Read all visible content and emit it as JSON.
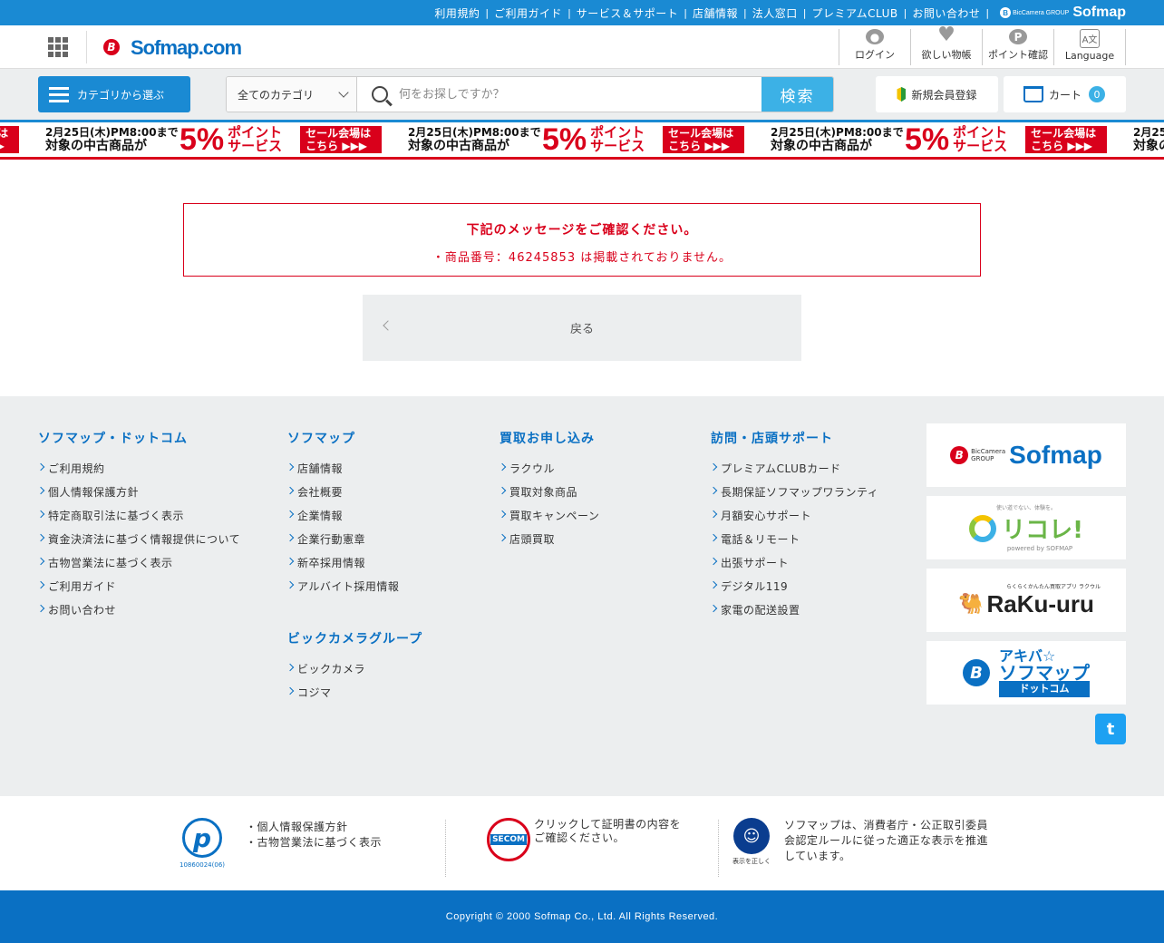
{
  "topbar": {
    "links": [
      "利用規約",
      "ご利用ガイド",
      "サービス＆サポート",
      "店舗情報",
      "法人窓口",
      "プレミアムCLUB",
      "お問い合わせ"
    ],
    "brand": "Sofmap",
    "brand_sub": "BicCamera GROUP"
  },
  "header": {
    "logo_text": "Sofmap",
    "logo_suffix": ".com",
    "menu": [
      {
        "label": "ログイン",
        "icon": "user-icon"
      },
      {
        "label": "欲しい物帳",
        "icon": "heart-icon"
      },
      {
        "label": "ポイント確認",
        "icon": "point-icon",
        "glyph": "P"
      },
      {
        "label": "Language",
        "icon": "language-icon",
        "glyph": "A文"
      }
    ]
  },
  "search": {
    "category_button": "カテゴリから選ぶ",
    "category_select": "全てのカテゴリ",
    "placeholder": "何をお探しですか？",
    "submit": "検索",
    "register": "新規会員登録",
    "cart_label": "カート",
    "cart_count": "0"
  },
  "banner": {
    "date_line": "2月25日(木)PM8:00まで",
    "target_line": "対象の中古商品が",
    "percent": "5%",
    "point_line1": "ポイント",
    "point_line2": "サービス",
    "sale_line1": "セール会場は",
    "sale_line2": "こちら ▶▶▶"
  },
  "message": {
    "heading": "下記のメッセージをご確認ください。",
    "body": "・商品番号：46245853 は掲載されておりません。"
  },
  "back_button": "戻る",
  "footer": {
    "columns": [
      {
        "title": "ソフマップ・ドットコム",
        "items": [
          "ご利用規約",
          "個人情報保護方針",
          "特定商取引法に基づく表示",
          "資金決済法に基づく情報提供について",
          "古物営業法に基づく表示",
          "ご利用ガイド",
          "お問い合わせ"
        ]
      },
      {
        "title": "ソフマップ",
        "items": [
          "店舗情報",
          "会社概要",
          "企業情報",
          "企業行動憲章",
          "新卒採用情報",
          "アルバイト採用情報"
        ]
      },
      {
        "title": "ビックカメラグループ",
        "items": [
          "ビックカメラ",
          "コジマ"
        ]
      },
      {
        "title": "買取お申し込み",
        "items": [
          "ラクウル",
          "買取対象商品",
          "買取キャンペーン",
          "店頭買取"
        ]
      },
      {
        "title": "訪問・店頭サポート",
        "items": [
          "プレミアムCLUBカード",
          "長期保証ソフマップワランティ",
          "月額安心サポート",
          "電話＆リモート",
          "出張サポート",
          "デジタル119",
          "家電の配送設置"
        ]
      }
    ],
    "logos": {
      "sofmap": "Sofmap",
      "sofmap_group": "BicCamera GROUP",
      "ricore": "リコレ!",
      "ricore_tag": "使い道でない、体験を。",
      "ricore_sub": "powered by SOFMAP",
      "rakuuru": "RaKu-uru",
      "rakuuru_tag": "らくらくかんたん買取アプリ ラクウル",
      "akiba_line1": "アキバ☆",
      "akiba_line2": "ソフマップ",
      "akiba_line3": "ドットコム"
    }
  },
  "certs": {
    "privacy_mark_number": "10860024(06)",
    "privacy_links": [
      "・個人情報保護方針",
      "・古物営業法に基づく表示"
    ],
    "secom_text": "クリックして証明書の内容をご確認ください。",
    "secom_badge": "SECOM",
    "fair_text": "ソフマップは、消費者庁・公正取引委員会認定ルールに従った適正な表示を推進しています。",
    "fair_caption": "表示を正しく"
  },
  "copyright": "Copyright © 2000 Sofmap Co., Ltd. All Rights Reserved.",
  "colors": {
    "brand_blue": "#1a8ad3",
    "dark_blue": "#0a70c3",
    "error_red": "#d9001b",
    "search_button": "#3cb1e6"
  }
}
